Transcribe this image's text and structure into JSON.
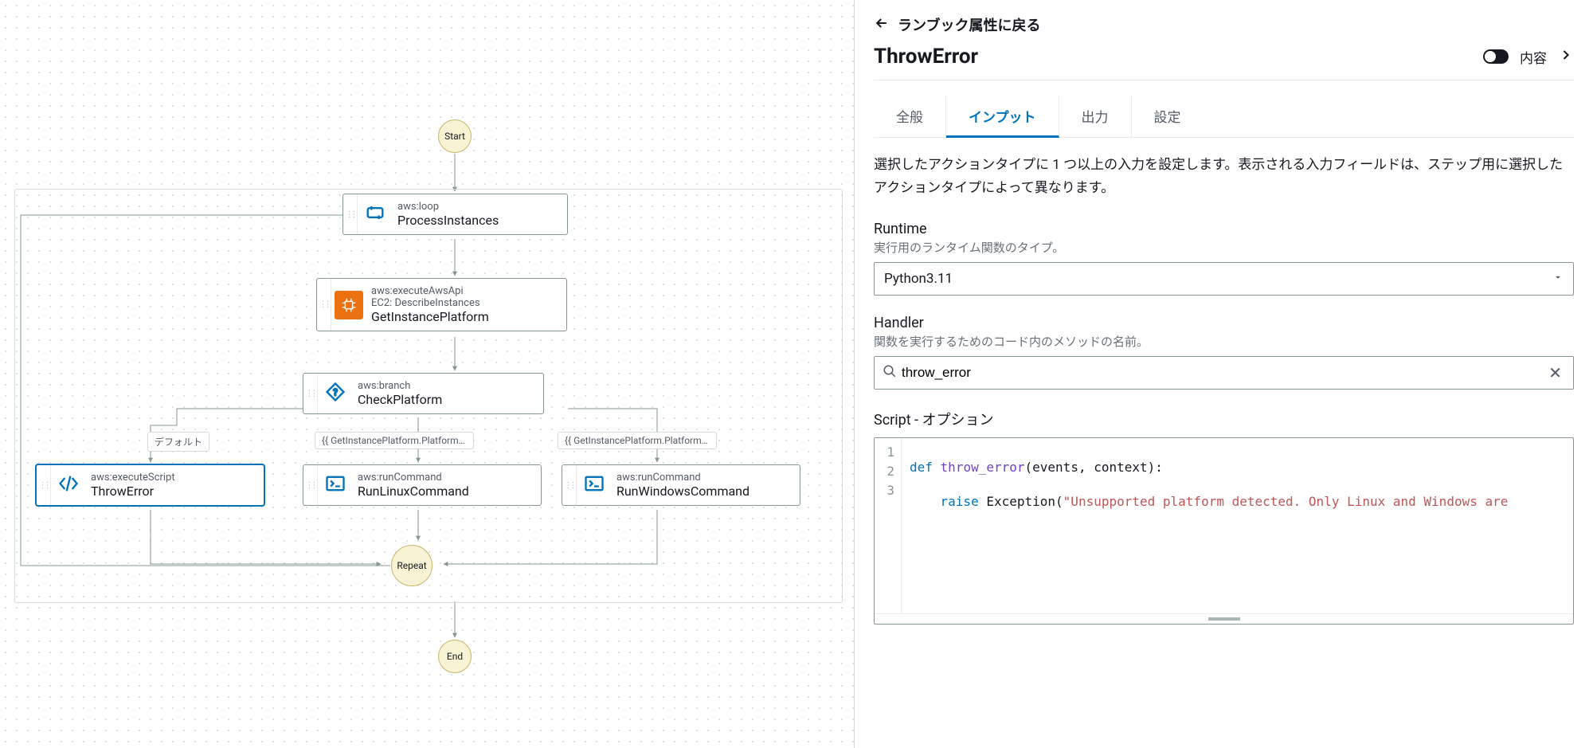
{
  "header": {
    "back_label": "ランブック属性に戻る",
    "title": "ThrowError",
    "toggle_label": "内容"
  },
  "tabs": {
    "general": "全般",
    "inputs": "インプット",
    "outputs": "出力",
    "settings": "設定"
  },
  "inputs_panel": {
    "description": "選択したアクションタイプに 1 つ以上の入力を設定します。表示される入力フィールドは、ステップ用に選択したアクションタイプによって異なります。",
    "runtime": {
      "label": "Runtime",
      "hint": "実行用のランタイム関数のタイプ。",
      "value": "Python3.11"
    },
    "handler": {
      "label": "Handler",
      "hint": "関数を実行するためのコード内のメソッドの名前。",
      "value": "throw_error"
    },
    "script": {
      "label": "Script - オプション"
    }
  },
  "code": {
    "kw_def": "def",
    "fn_name": "throw_error",
    "params": "(events, context):",
    "kw_raise": "raise",
    "exc": "Exception(",
    "msg": "\"Unsupported platform detected. Only Linux and Windows are ",
    "line3": ""
  },
  "flow": {
    "start": "Start",
    "end": "End",
    "repeat": "Repeat",
    "loop": {
      "action": "aws:loop",
      "name": "ProcessInstances"
    },
    "api": {
      "action": "aws:executeAwsApi",
      "sub": "EC2: DescribeInstances",
      "name": "GetInstancePlatform"
    },
    "branch": {
      "action": "aws:branch",
      "name": "CheckPlatform"
    },
    "script": {
      "action": "aws:executeScript",
      "name": "ThrowError"
    },
    "linux": {
      "action": "aws:runCommand",
      "name": "RunLinuxCommand"
    },
    "win": {
      "action": "aws:runCommand",
      "name": "RunWindowsCommand"
    },
    "label_default": "デフォルト",
    "label_linux": "{{ GetInstancePlatform.Platform }} conta...",
    "label_win": "{{ GetInstancePlatform.Platform }} conta..."
  }
}
